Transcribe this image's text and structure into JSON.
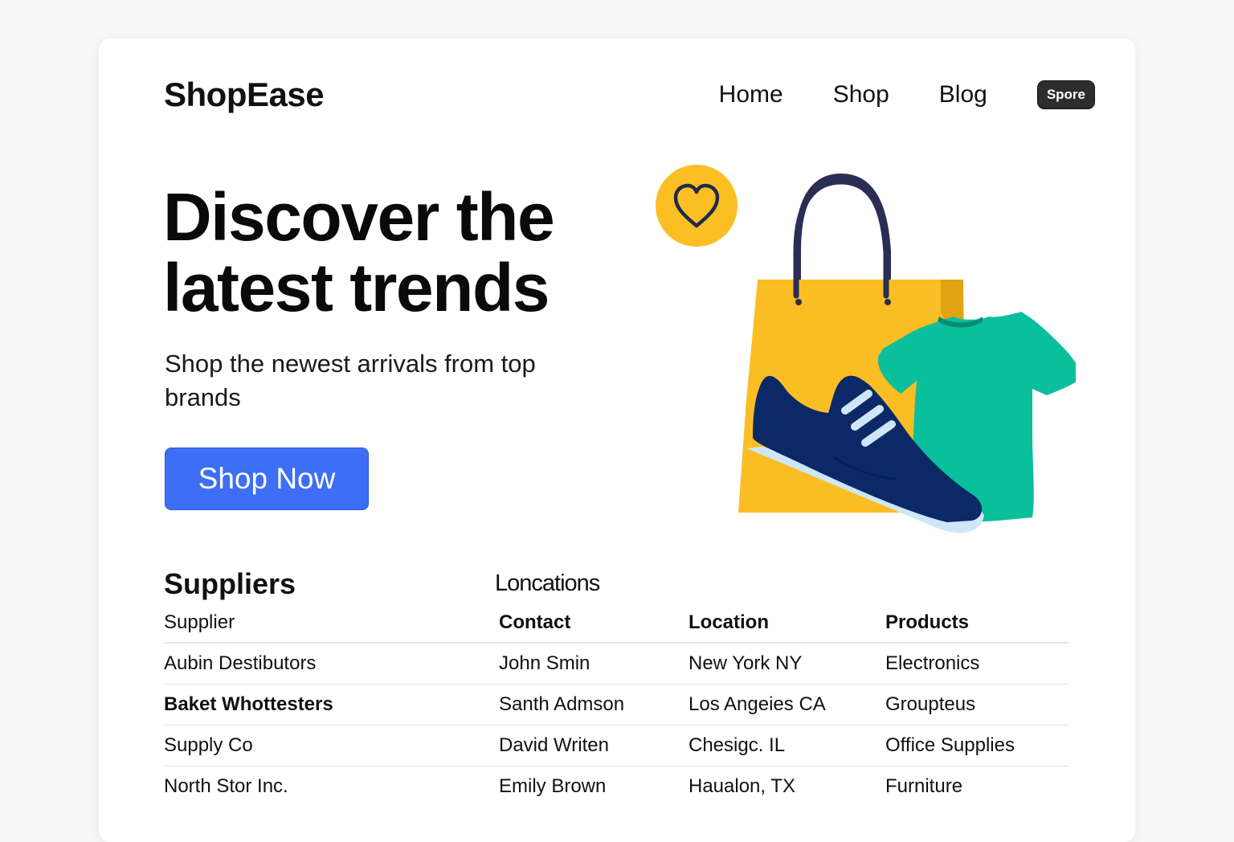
{
  "header": {
    "logo": "ShopEase",
    "nav": [
      "Home",
      "Shop",
      "Blog"
    ],
    "badge": "Spore"
  },
  "hero": {
    "title_line1": "Discover the",
    "title_line2": "latest trends",
    "subtitle": "Shop the newest arrivals from top brands",
    "cta_label": "Shop Now"
  },
  "suppliers": {
    "title": "Suppliers",
    "subtitle": "Loncations",
    "columns": [
      "Supplier",
      "Contact",
      "Location",
      "Products"
    ],
    "rows": [
      [
        "Aubin Destibutors",
        "John Smin",
        "New York NY",
        "Electronics"
      ],
      [
        "Baket Whottesters",
        "Santh Admson",
        "Los Angeies CA",
        "Groupteus"
      ],
      [
        "Supply Co",
        "David Writen",
        "Chesigc. IL",
        "Office Supplies"
      ],
      [
        "North Stor Inc.",
        "Emily Brown",
        "Haualon, TX",
        "Furniture"
      ]
    ]
  },
  "illustration": {
    "icons": [
      "heart-icon",
      "shopping-bag-icon",
      "sneaker-icon",
      "t-shirt-icon"
    ],
    "colors": {
      "accent_yellow": "#fbbf24",
      "bag_yellow": "#fbbd24",
      "tshirt_teal": "#0abf9c",
      "shoe_navy": "#0b2966",
      "shoe_sole": "#cfe6f8",
      "handle_navy": "#2a2e55"
    }
  },
  "colors": {
    "primary": "#3d6ef5",
    "badge_bg": "#2d2d2d",
    "text": "#111111"
  }
}
